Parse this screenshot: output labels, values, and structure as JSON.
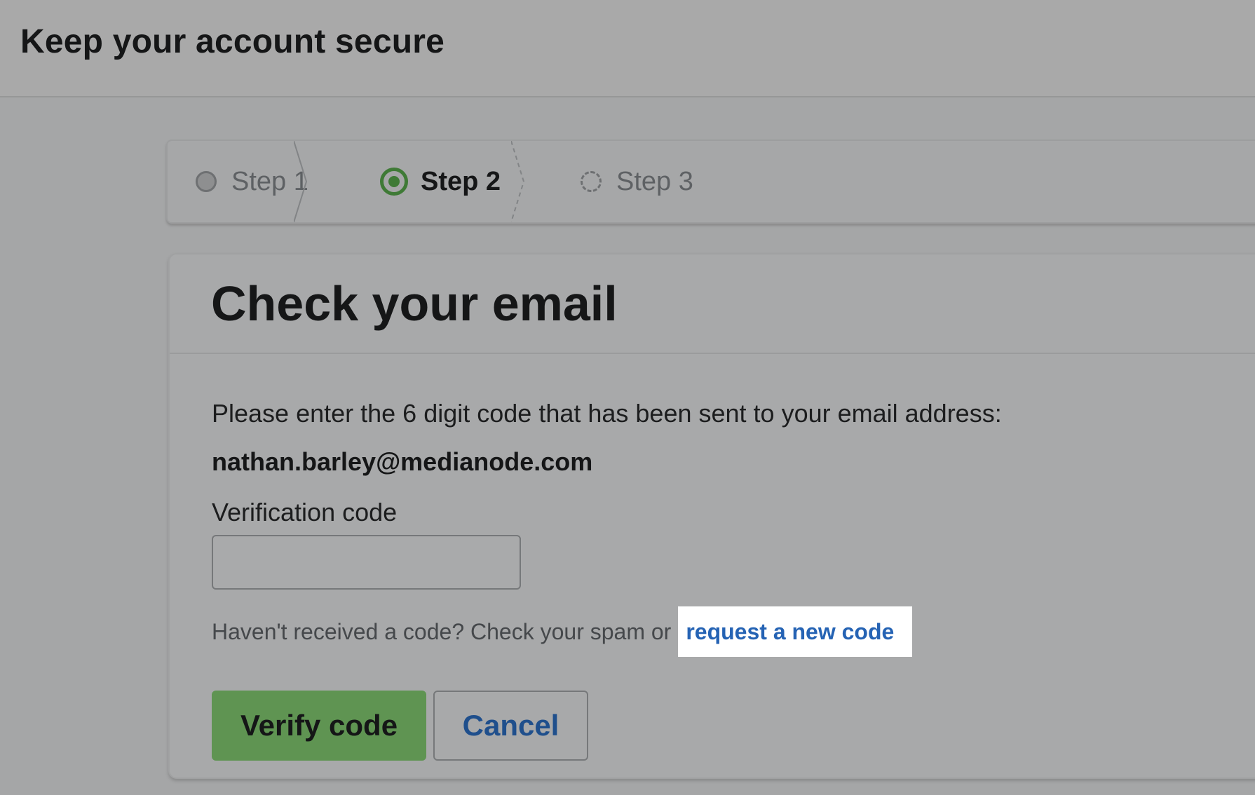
{
  "header": {
    "title": "Keep your account secure"
  },
  "stepper": {
    "steps": [
      {
        "label": "Step 1",
        "state": "completed"
      },
      {
        "label": "Step 2",
        "state": "current"
      },
      {
        "label": "Step 3",
        "state": "upcoming"
      }
    ],
    "colors": {
      "current": "#3f7a36",
      "inactive": "#6e7072"
    }
  },
  "card": {
    "title": "Check your email",
    "instruction": "Please enter the 6 digit code that has been sent to your email address:",
    "email": "nathan.barley@medianode.com",
    "code_field": {
      "label": "Verification code",
      "value": "",
      "placeholder": ""
    },
    "hint": {
      "text": "Haven't received a code? Check your spam or",
      "link_label": "request a new code"
    },
    "buttons": {
      "verify_label": "Verify code",
      "cancel_label": "Cancel"
    },
    "colors": {
      "primary_button": "#5f9452",
      "link": "#2563b4",
      "cancel_text": "#1f4f8c"
    }
  }
}
